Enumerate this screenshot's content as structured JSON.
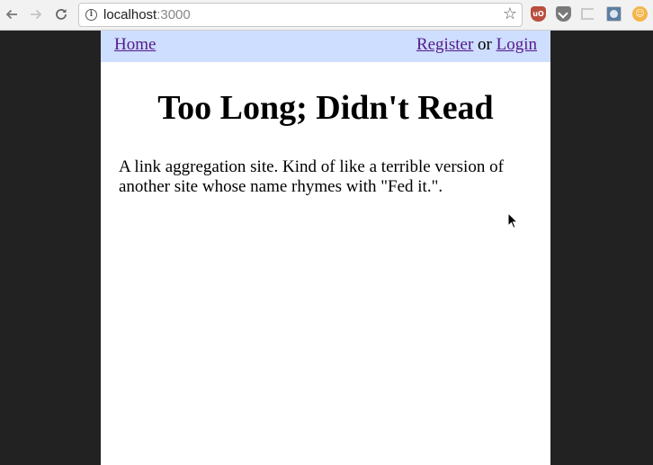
{
  "browser": {
    "url_host": "localhost",
    "url_port": ":3000",
    "star_glyph": "☆",
    "icons": [
      "back-arrow-icon",
      "forward-arrow-icon",
      "reload-icon",
      "info-icon",
      "bookmark-star-icon",
      "ublock-icon",
      "pocket-icon",
      "bracket-extension-icon",
      "photo-extension-icon",
      "orange-extension-icon"
    ]
  },
  "nav": {
    "home": "Home",
    "register": "Register",
    "or": " or ",
    "login": "Login"
  },
  "main": {
    "title": "Too Long; Didn't Read",
    "description": "A link aggregation site. Kind of like a terrible version of another site whose name rhymes with \"Fed it.\"."
  },
  "colors": {
    "navbar_bg": "#cedeff",
    "link": "#551a8b",
    "outer_bg": "#222222"
  }
}
